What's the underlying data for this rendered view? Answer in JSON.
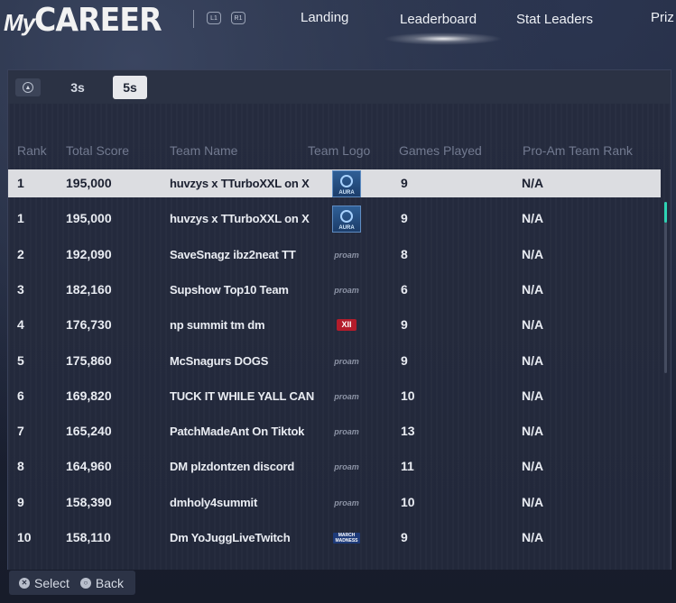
{
  "header": {
    "logo_my": "My",
    "logo_career": "CAREER",
    "bumper_left": "L1",
    "bumper_right": "R1",
    "nav": [
      {
        "label": "Landing",
        "active": false
      },
      {
        "label": "Leaderboard",
        "active": true
      },
      {
        "label": "Stat Leaders",
        "active": false
      },
      {
        "label": "Priz",
        "active": false
      }
    ]
  },
  "tabs": {
    "icon": "triangle-button-icon",
    "items": [
      {
        "label": "3s",
        "active": false
      },
      {
        "label": "5s",
        "active": true
      }
    ]
  },
  "table": {
    "columns": [
      "Rank",
      "Total Score",
      "Team Name",
      "Team Logo",
      "Games Played",
      "Pro-Am Team Rank"
    ],
    "rows": [
      {
        "rank": "1",
        "score": "195,000",
        "team": "huvzys x TTurboXXL on X",
        "logo": "aura-logo",
        "logo_text": "AURA",
        "games": "9",
        "proam_rank": "N/A",
        "selected": true
      },
      {
        "rank": "1",
        "score": "195,000",
        "team": "huvzys x TTurboXXL on X",
        "logo": "aura-logo",
        "logo_text": "AURA",
        "games": "9",
        "proam_rank": "N/A",
        "selected": false
      },
      {
        "rank": "2",
        "score": "192,090",
        "team": "SaveSnagz ibz2neat TT",
        "logo": "proam-logo",
        "logo_text": "proam",
        "games": "8",
        "proam_rank": "N/A",
        "selected": false
      },
      {
        "rank": "3",
        "score": "182,160",
        "team": "Supshow Top10 Team",
        "logo": "proam-logo",
        "logo_text": "proam",
        "games": "6",
        "proam_rank": "N/A",
        "selected": false
      },
      {
        "rank": "4",
        "score": "176,730",
        "team": "np summit tm dm",
        "logo": "xii-logo",
        "logo_text": "XII",
        "games": "9",
        "proam_rank": "N/A",
        "selected": false
      },
      {
        "rank": "5",
        "score": "175,860",
        "team": "McSnagurs DOGS",
        "logo": "proam-logo",
        "logo_text": "proam",
        "games": "9",
        "proam_rank": "N/A",
        "selected": false
      },
      {
        "rank": "6",
        "score": "169,820",
        "team": "TUCK IT WHILE YALL CAN",
        "logo": "proam-logo",
        "logo_text": "proam",
        "games": "10",
        "proam_rank": "N/A",
        "selected": false
      },
      {
        "rank": "7",
        "score": "165,240",
        "team": "PatchMadeAnt On Tiktok",
        "logo": "proam-logo",
        "logo_text": "proam",
        "games": "13",
        "proam_rank": "N/A",
        "selected": false
      },
      {
        "rank": "8",
        "score": "164,960",
        "team": "DM plzdontzen discord",
        "logo": "proam-logo",
        "logo_text": "proam",
        "games": "11",
        "proam_rank": "N/A",
        "selected": false
      },
      {
        "rank": "9",
        "score": "158,390",
        "team": "dmholy4summit",
        "logo": "proam-logo",
        "logo_text": "proam",
        "games": "10",
        "proam_rank": "N/A",
        "selected": false
      },
      {
        "rank": "10",
        "score": "158,110",
        "team": "Dm YoJuggLiveTwitch",
        "logo": "march-madness-logo",
        "logo_text": "MARCH MADNESS",
        "games": "9",
        "proam_rank": "N/A",
        "selected": false
      }
    ]
  },
  "footer": {
    "select_label": "Select",
    "back_label": "Back"
  },
  "colors": {
    "accent_scroll": "#2ed3b4",
    "selected_row_bg": "#dcdde1",
    "panel_bg": "#1f2537"
  }
}
